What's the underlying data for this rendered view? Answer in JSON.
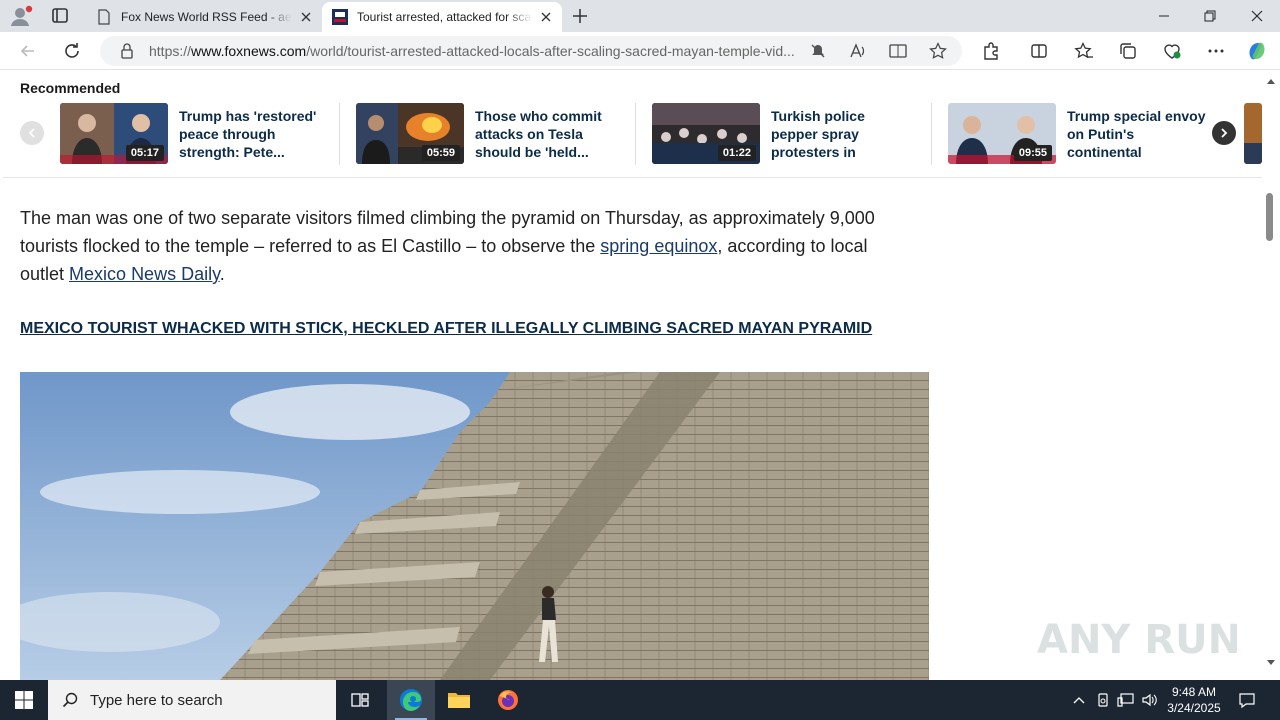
{
  "browser": {
    "tabs": [
      {
        "title": "Fox News World RSS Feed - aerop",
        "active": false
      },
      {
        "title": "Tourist arrested, attacked for scal",
        "active": true
      }
    ],
    "url": {
      "prefix": "https://",
      "host": "www.foxnews.com",
      "path": "/world/tourist-arrested-attacked-locals-after-scaling-sacred-mayan-temple-vid..."
    }
  },
  "recommended": {
    "heading": "Recommended",
    "items": [
      {
        "duration": "05:17",
        "title": "Trump has 'restored' peace through strength: Pete..."
      },
      {
        "duration": "05:59",
        "title": "Those who commit attacks on Tesla should be 'held..."
      },
      {
        "duration": "01:22",
        "title": "Turkish police pepper spray protesters in Istanbul"
      },
      {
        "duration": "09:55",
        "title": "Trump special envoy on Putin's continental aspirations: 'I just do..."
      }
    ]
  },
  "article": {
    "para_1": "The man was one of two separate visitors filmed climbing the pyramid on Thursday, as approximately 9,000 tourists flocked to the temple – referred to as El Castillo – to observe the ",
    "link_1": "spring equinox",
    "para_2": ", according to local outlet ",
    "link_2": "Mexico News Daily",
    "para_3": ".",
    "headline_link": "MEXICO TOURIST WHACKED WITH STICK, HECKLED AFTER ILLEGALLY CLIMBING SACRED MAYAN PYRAMID"
  },
  "watermark": "ANY RUN",
  "taskbar": {
    "search_placeholder": "Type here to search",
    "time": "9:48 AM",
    "date": "3/24/2025"
  },
  "colors": {
    "link": "#1a3a6b",
    "headline": "#0b2b48",
    "taskbar": "#1c2632"
  }
}
